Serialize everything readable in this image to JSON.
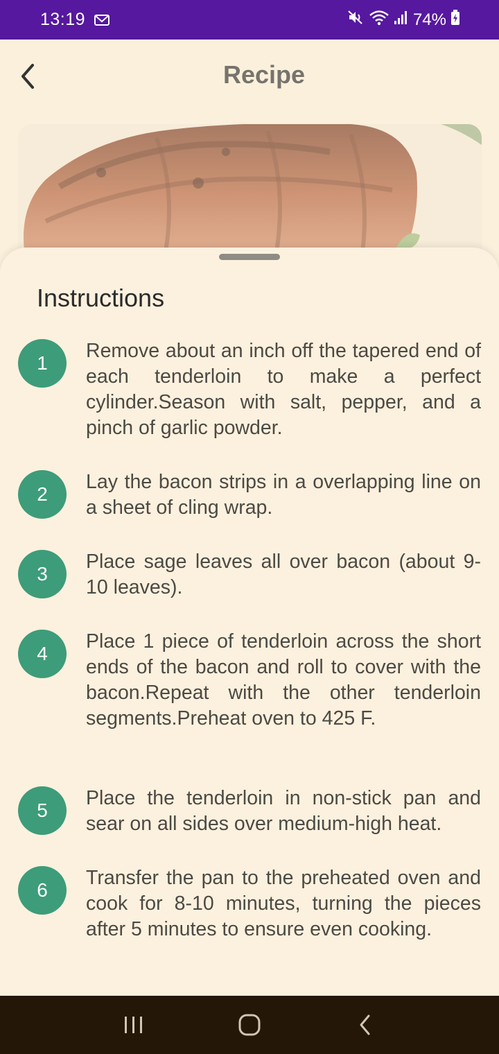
{
  "status_bar": {
    "time": "13:19",
    "battery": "74%",
    "icons": [
      "mail-icon",
      "mute-icon",
      "wifi-icon",
      "signal-icon",
      "battery-charging-icon"
    ]
  },
  "header": {
    "title": "Recipe",
    "back_icon": "back-arrow-icon"
  },
  "hero_image": {
    "subject": "bacon-wrapped tenderloin photo"
  },
  "sheet": {
    "title": "Instructions",
    "steps": [
      {
        "number": "1",
        "text": "Remove about an inch off the tapered end of each tenderloin to make a perfect cylinder.Season with salt, pepper, and a pinch of garlic powder."
      },
      {
        "number": "2",
        "text": "Lay the bacon strips in a overlapping line on a sheet of cling wrap."
      },
      {
        "number": "3",
        "text": "Place sage leaves all over bacon (about 9-10 leaves)."
      },
      {
        "number": "4",
        "text": "Place 1 piece of tenderloin across the short ends of the bacon and roll to cover with the bacon.Repeat with the other tenderloin segments.Preheat oven to 425 F."
      },
      {
        "number": "5",
        "text": "Place the tenderloin in non-stick pan and sear on all sides over medium-high heat."
      },
      {
        "number": "6",
        "text": "Transfer the pan to the preheated oven and cook for 8-10 minutes, turning the pieces after 5 minutes to ensure even cooking."
      }
    ]
  },
  "nav_bar": {
    "buttons": [
      "recents-icon",
      "home-icon",
      "back-icon"
    ]
  },
  "colors": {
    "status_bar": "#56189e",
    "accent": "#3d9c7a",
    "background": "#fbf0dc",
    "nav_bar": "#241707"
  }
}
